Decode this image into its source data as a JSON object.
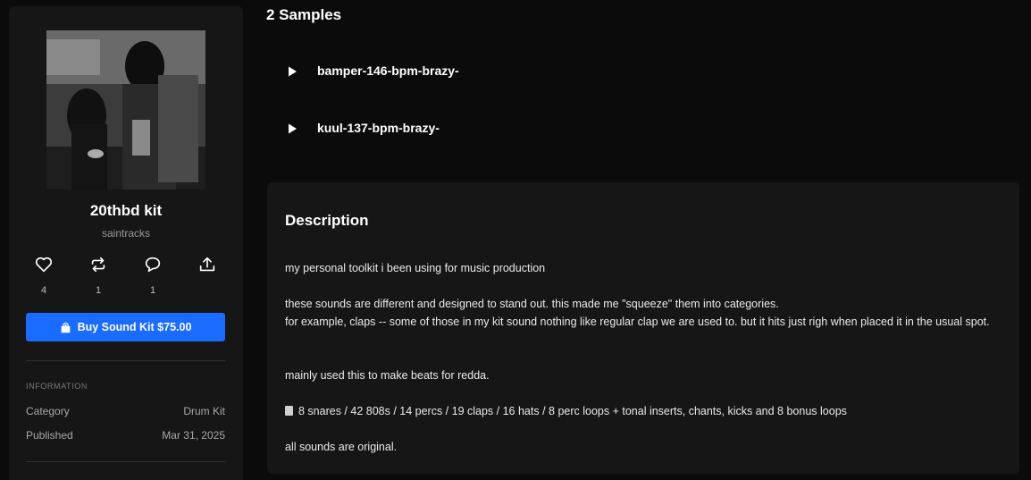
{
  "sidebar": {
    "cover_alt": "kit cover artwork",
    "title": "20thbd kit",
    "author": "saintracks",
    "stats": {
      "likes": "4",
      "reposts": "1",
      "comments": "1"
    },
    "buy_label": "Buy Sound Kit $75.00",
    "info_heading": "INFORMATION",
    "info": [
      {
        "key": "Category",
        "value": "Drum Kit"
      },
      {
        "key": "Published",
        "value": "Mar 31, 2025"
      }
    ]
  },
  "samples": {
    "title": "2 Samples",
    "items": [
      {
        "name": "bamper-146-bpm-brazy-"
      },
      {
        "name": "kuul-137-bpm-brazy-"
      }
    ]
  },
  "description": {
    "title": "Description",
    "p1": "my personal toolkit i been using for music production",
    "p2a": "these sounds are different and designed to stand out. this made me \"squeeze\" them into categories.",
    "p2b": "for example, claps -- some of those in my kit sound nothing like regular clap we are used to. but it hits just righ when placed it in the usual spot.",
    "p3": "mainly used this to make beats for redda.",
    "p4": "8 snares / 42 808s / 14 percs / 19 claps / 16 hats / 8 perc loops + tonal inserts, chants, kicks and 8 bonus loops",
    "p5": "all sounds are original."
  },
  "colors": {
    "accent": "#1a6bff",
    "background": "#0b0b0b",
    "card": "#161616"
  },
  "icons": [
    "heart-icon",
    "repost-icon",
    "comment-icon",
    "share-icon",
    "bag-icon",
    "play-icon"
  ]
}
